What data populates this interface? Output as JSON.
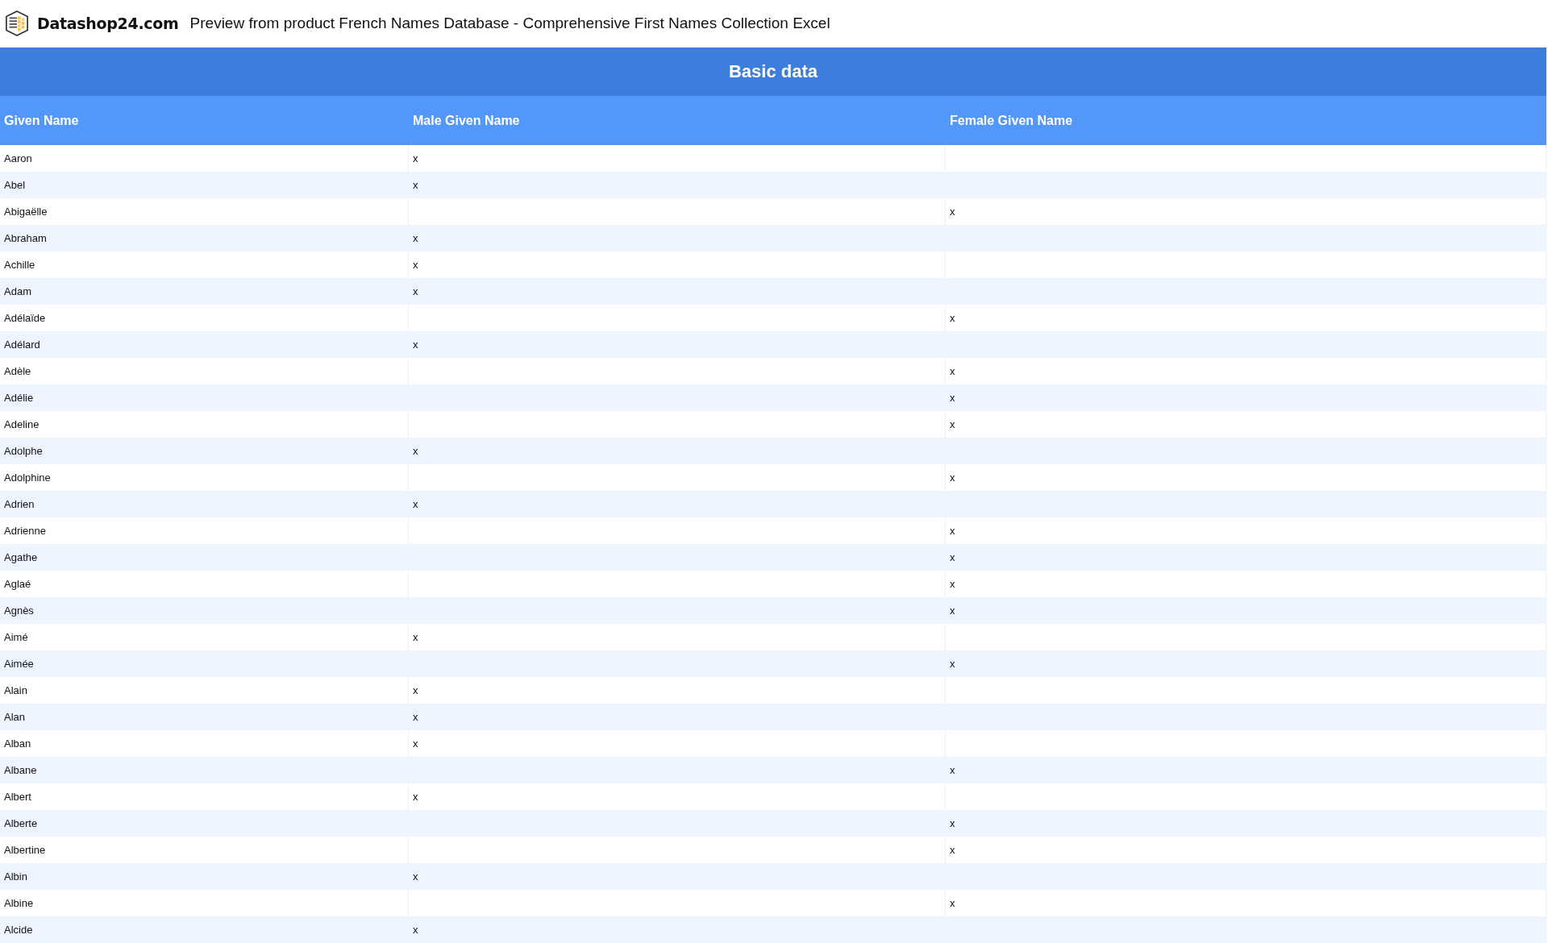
{
  "header": {
    "logo_text": "Datashop24.com",
    "title": "Preview from product French Names Database - Comprehensive First Names Collection Excel"
  },
  "table": {
    "title": "Basic data",
    "columns": [
      "Given Name",
      "Male Given Name",
      "Female Given Name"
    ],
    "rows": [
      {
        "name": "Aaron",
        "male": "x"
      },
      {
        "name": "Abel",
        "male": "x"
      },
      {
        "name": "Abigaëlle",
        "female": "x"
      },
      {
        "name": "Abraham",
        "male": "x"
      },
      {
        "name": "Achille",
        "male": "x"
      },
      {
        "name": "Adam",
        "male": "x"
      },
      {
        "name": "Adélaïde",
        "female": "x"
      },
      {
        "name": "Adélard",
        "male": "x"
      },
      {
        "name": "Adèle",
        "female": "x"
      },
      {
        "name": "Adélie",
        "female": "x"
      },
      {
        "name": "Adeline",
        "female": "x"
      },
      {
        "name": "Adolphe",
        "male": "x"
      },
      {
        "name": "Adolphine",
        "female": "x"
      },
      {
        "name": "Adrien",
        "male": "x"
      },
      {
        "name": "Adrienne",
        "female": "x"
      },
      {
        "name": "Agathe",
        "female": "x"
      },
      {
        "name": "Aglaé",
        "female": "x"
      },
      {
        "name": "Agnès",
        "female": "x"
      },
      {
        "name": "Aimé",
        "male": "x"
      },
      {
        "name": "Aimée",
        "female": "x"
      },
      {
        "name": "Alain",
        "male": "x"
      },
      {
        "name": "Alan",
        "male": "x"
      },
      {
        "name": "Alban",
        "male": "x"
      },
      {
        "name": "Albane",
        "female": "x"
      },
      {
        "name": "Albert",
        "male": "x"
      },
      {
        "name": "Alberte",
        "female": "x"
      },
      {
        "name": "Albertine",
        "female": "x"
      },
      {
        "name": "Albin",
        "male": "x"
      },
      {
        "name": "Albine",
        "female": "x"
      },
      {
        "name": "Alcide",
        "male": "x"
      }
    ]
  }
}
